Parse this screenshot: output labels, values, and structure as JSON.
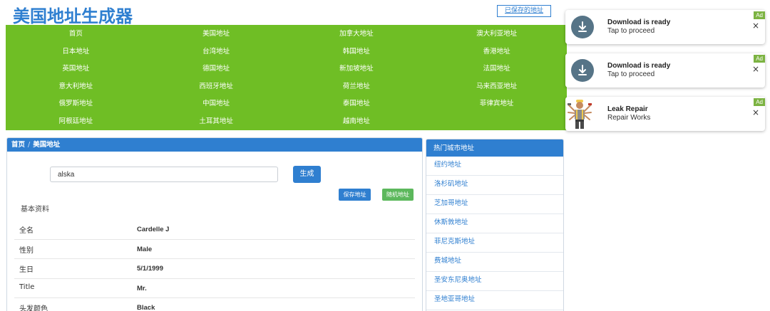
{
  "header": {
    "title": "美国地址生成器",
    "saved_link": "已保存的地址"
  },
  "nav": {
    "items": [
      "首页",
      "美国地址",
      "加拿大地址",
      "澳大利亚地址",
      "日本地址",
      "台湾地址",
      "韩国地址",
      "香港地址",
      "英国地址",
      "德国地址",
      "新加坡地址",
      "法国地址",
      "意大利地址",
      "西班牙地址",
      "荷兰地址",
      "马来西亚地址",
      "俄罗斯地址",
      "中国地址",
      "泰国地址",
      "菲律宾地址",
      "阿根廷地址",
      "土耳其地址",
      "越南地址"
    ]
  },
  "breadcrumb": {
    "home": "首页",
    "separator": "/",
    "current": "美国地址"
  },
  "search": {
    "value": "alska",
    "generate_label": "生成"
  },
  "actions": {
    "save_label": "保存地址",
    "random_label": "随机地址"
  },
  "profile": {
    "section_title": "基本资料",
    "rows": [
      {
        "label": "全名",
        "value": "Cardelle J"
      },
      {
        "label": "性别",
        "value": "Male"
      },
      {
        "label": "生日",
        "value": "5/1/1999"
      },
      {
        "label": "Title",
        "value": "Mr."
      },
      {
        "label": "头发颜色",
        "value": "Black"
      }
    ]
  },
  "sidebar": {
    "title": "热门城市地址",
    "items": [
      "纽约地址",
      "洛杉矶地址",
      "芝加哥地址",
      "休斯敦地址",
      "菲尼克斯地址",
      "费城地址",
      "圣安东尼奥地址",
      "圣地亚哥地址"
    ]
  },
  "ads": [
    {
      "title": "Download is ready",
      "subtitle": "Tap to proceed",
      "badge": "Ad",
      "close": "×",
      "icon": "download-icon"
    },
    {
      "title": "Download is ready",
      "subtitle": "Tap to proceed",
      "badge": "Ad",
      "close": "×",
      "icon": "download-icon"
    },
    {
      "title": "Leak Repair",
      "subtitle": "Repair Works",
      "badge": "Ad",
      "close": "×",
      "icon": "repairman-photo"
    }
  ],
  "colors": {
    "brand_blue": "#2f7fd0",
    "nav_green": "#6fbe25",
    "random_green": "#5cb85c",
    "ad_badge_green": "#7cb342",
    "download_circle": "#567487"
  }
}
